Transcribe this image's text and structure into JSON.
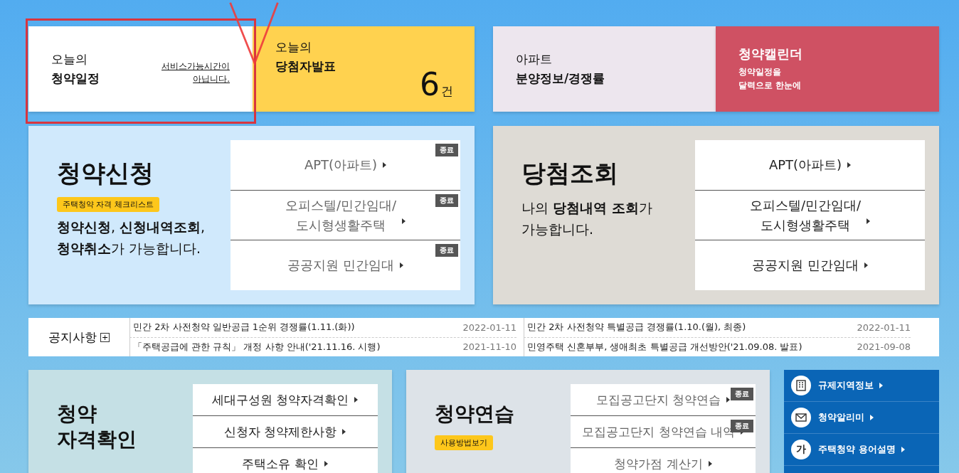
{
  "quick_cards": [
    {
      "kind": "schedule",
      "line1": "오늘의",
      "line2": "청약일정",
      "link_lines": [
        "서비스가능시간이",
        "아닙니다."
      ]
    },
    {
      "kind": "winners",
      "line1": "오늘의",
      "line2": "당첨자발표",
      "count": "6",
      "unit": "건"
    },
    {
      "kind": "apt",
      "line1": "아파트",
      "line2": "분양정보/경쟁률"
    },
    {
      "kind": "calendar",
      "title": "청약캘린더",
      "desc_lines": [
        "청약일정을",
        "달력으로 한눈에"
      ]
    }
  ],
  "apply": {
    "title": "청약신청",
    "tag": "주택청약 자격 체크리스트",
    "desc": "**청약신청**, **신청내역조회**, **청약취소**가 가능합니다.",
    "menu": [
      {
        "label_lines": [
          "APT(아파트)"
        ],
        "badge": "종료"
      },
      {
        "label_lines": [
          "오피스텔/민간임대/",
          "도시형생활주택"
        ],
        "badge": "종료"
      },
      {
        "label_lines": [
          "공공지원 민간임대"
        ],
        "badge": "종료"
      }
    ]
  },
  "winning": {
    "title": "당첨조회",
    "desc": "나의 **당첨내역 조회**가 가능합니다.",
    "menu": [
      {
        "label_lines": [
          "APT(아파트)"
        ]
      },
      {
        "label_lines": [
          "오피스텔/민간임대/",
          "도시형생활주택"
        ]
      },
      {
        "label_lines": [
          "공공지원 민간임대"
        ]
      }
    ]
  },
  "notices": {
    "title": "공지사항",
    "more": "+",
    "items": [
      {
        "title": "민간 2차 사전청약 일반공급 1순위 경쟁률(1.11.(화))",
        "date": "2022-01-11"
      },
      {
        "title": "민간 2차 사전청약 특별공급 경쟁률(1.10.(월), 최종)",
        "date": "2022-01-11"
      },
      {
        "title": "「주택공급에 관한 규칙」 개정 사항 안내('21.11.16. 시행)",
        "date": "2021-11-10"
      },
      {
        "title": "민영주택 신혼부부, 생애최초 특별공급 개선방안('21.09.08. 발표)",
        "date": "2021-09-08"
      }
    ]
  },
  "eligibility": {
    "title_lines": [
      "청약",
      "자격확인"
    ],
    "menu": [
      {
        "label": "세대구성원 청약자격확인"
      },
      {
        "label": "신청자 청약제한사항"
      },
      {
        "label": "주택소유 확인"
      }
    ]
  },
  "practice": {
    "title": "청약연습",
    "tag": "사용방법보기",
    "menu": [
      {
        "label": "모집공고단지 청약연습",
        "badge": "종료"
      },
      {
        "label": "모집공고단지 청약연습 내역",
        "badge": "종료"
      },
      {
        "label": "청약가점 계산기"
      }
    ]
  },
  "links": [
    {
      "kind": "building",
      "label": "규제지역정보"
    },
    {
      "kind": "mail",
      "label": "청약알리미"
    },
    {
      "kind": "text",
      "icon_text": "가",
      "label": "주택청약 용어설명"
    }
  ]
}
